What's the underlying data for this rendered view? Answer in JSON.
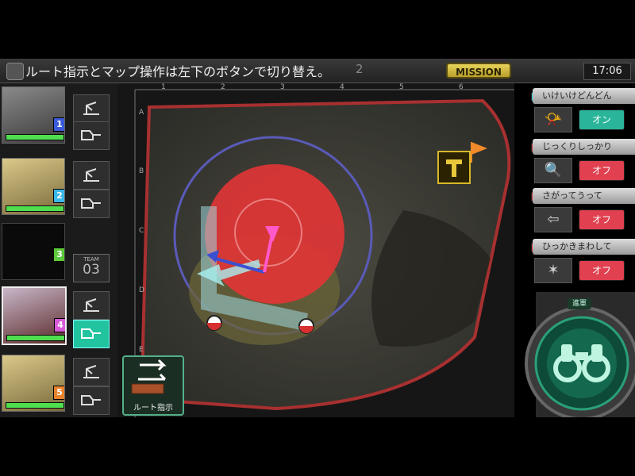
{
  "hint": {
    "text": "ルート指示とマップ操作は左下のボタンで切り替え。",
    "page": "2"
  },
  "header": {
    "mission_label": "MISSION",
    "clock": "17:06"
  },
  "map": {
    "columns": [
      "1",
      "2",
      "3",
      "4",
      "5",
      "6"
    ],
    "rows": [
      "A",
      "B",
      "C",
      "D",
      "E"
    ]
  },
  "roster": {
    "units": [
      {
        "number": "1",
        "color": "#3a5ad8",
        "hp": 1.0
      },
      {
        "number": "2",
        "color": "#3ab8e8",
        "hp": 1.0
      },
      {
        "number": "3",
        "color": "#5cc83a",
        "hp": 0
      },
      {
        "number": "4",
        "color": "#d85ad8",
        "hp": 1.0
      },
      {
        "number": "5",
        "color": "#e8822a",
        "hp": 1.0
      }
    ],
    "team_tag": {
      "word": "TEAM",
      "number": "03"
    }
  },
  "route_button": {
    "label": "ルート指示"
  },
  "tactics": [
    {
      "name": "いけいけどんどん",
      "state": "オン",
      "on": true
    },
    {
      "name": "じっくりしっかり",
      "state": "オフ",
      "on": false
    },
    {
      "name": "さがってうって",
      "state": "オフ",
      "on": false
    },
    {
      "name": "ひっかきまわして",
      "state": "オフ",
      "on": false
    }
  ],
  "advance": {
    "label": "進軍"
  },
  "colors": {
    "accent_green": "#2ab59a",
    "off_red": "#e04050",
    "mission_gold": "#d8c04a"
  }
}
